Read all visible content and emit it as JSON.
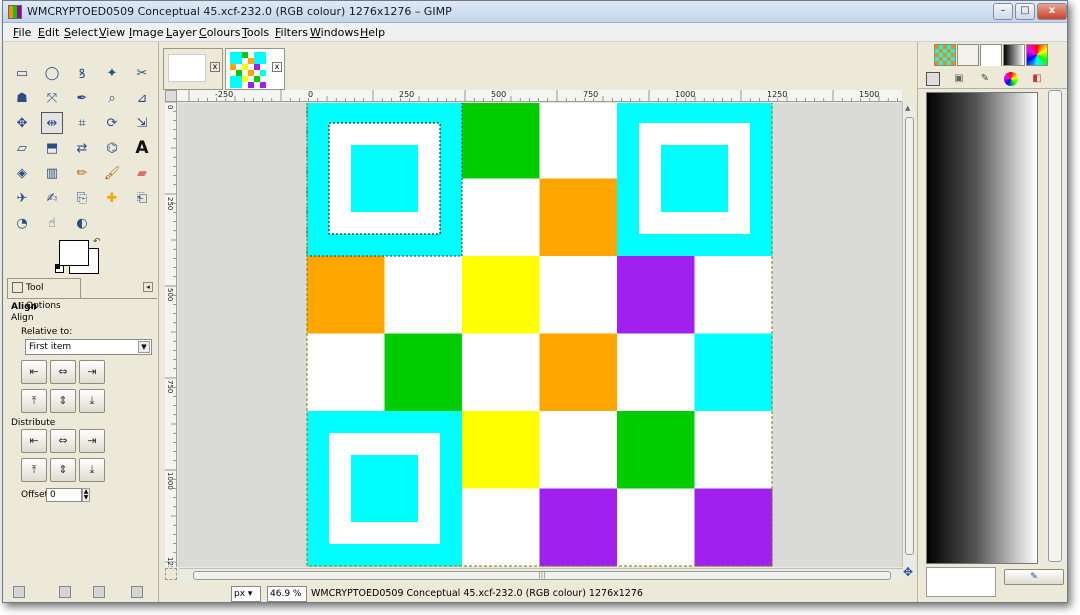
{
  "window": {
    "title": "WMCRYPTOED0509 Conceptual 45.xcf-232.0 (RGB colour) 1276x1276 – GIMP",
    "minimize": "–",
    "maximize": "□",
    "close": "x"
  },
  "menu": [
    "File",
    "Edit",
    "Select",
    "View",
    "Image",
    "Layer",
    "Colours",
    "Tools",
    "Filters",
    "Windows",
    "Help"
  ],
  "toolbox": {
    "tools": [
      "rect-select",
      "ellipse-select",
      "free-select",
      "fuzzy-select",
      "scissors-select",
      "fg-select",
      "paths",
      "color-picker",
      "zoom",
      "measure",
      "move",
      "align",
      "crop",
      "rotate",
      "scale",
      "shear",
      "perspective",
      "flip",
      "cage",
      "text",
      "bucket-fill",
      "blend",
      "pencil",
      "paintbrush",
      "eraser",
      "airbrush",
      "ink",
      "clone",
      "heal",
      "perspective-clone",
      "blur",
      "smudge",
      "dodge-burn"
    ],
    "active_tool": "align",
    "swap_glyph": "↶"
  },
  "tool_options": {
    "tab_label": "Tool Options",
    "panel_menu_glyph": "◂",
    "title": "Align",
    "subtitle": "Align",
    "relative_label": "Relative to:",
    "relative_value": "First item",
    "align_buttons": [
      "⇤",
      "⇔",
      "⇥",
      "⤒",
      "⇕",
      "⤓"
    ],
    "distribute_label": "Distribute",
    "distribute_buttons": [
      "⇤",
      "⇔",
      "⇥",
      "⤒",
      "⇕",
      "⤓"
    ],
    "offset_label": "Offset:",
    "offset_value": "0"
  },
  "image_tabs": [
    {
      "name": "blank-image",
      "close": "x"
    },
    {
      "name": "pattern-image",
      "close": "x"
    }
  ],
  "ruler_h": [
    "-250",
    "0",
    "250",
    "500",
    "750",
    "1000",
    "1250",
    "1500"
  ],
  "ruler_v": [
    "0",
    "250",
    "500",
    "750",
    "1000",
    "1250"
  ],
  "canvas": {
    "grid_colors": [
      [
        "#00ffff",
        "#00ffff",
        "#00cc00",
        "#ffffff",
        "#00ffff",
        "#00ffff"
      ],
      [
        "#00ffff",
        "#00ffff",
        "#ffffff",
        "#ffa500",
        "#00ffff",
        "#00ffff"
      ],
      [
        "#ffa500",
        "#ffffff",
        "#ffff00",
        "#ffffff",
        "#a020f0",
        "#ffffff"
      ],
      [
        "#ffffff",
        "#00cc00",
        "#ffffff",
        "#ffa500",
        "#ffffff",
        "#00ffff"
      ],
      [
        "#00ffff",
        "#00ffff",
        "#ffff00",
        "#ffffff",
        "#00cc00",
        "#ffffff"
      ],
      [
        "#00ffff",
        "#00ffff",
        "#ffffff",
        "#a020f0",
        "#ffffff",
        "#a020f0"
      ]
    ],
    "finder_inner": "#00ffff",
    "finder_ring": "#ffffff"
  },
  "scroll": {
    "center_glyph": "|||"
  },
  "statusbar": {
    "unit": "px",
    "zoom": "46.9 %",
    "text": "WMCRYPTOED0509 Conceptual 45.xcf-232.0 (RGB colour) 1276x1276"
  },
  "dock": {
    "tabs": [
      "patterns",
      "brushes",
      "tool-preset",
      "gradients",
      "palettes"
    ],
    "icons": [
      "gimp-icon",
      "printer-icon",
      "brush-icon",
      "color-wheel-icon",
      "swatch-icon"
    ],
    "gradient_colors": [
      "#000000",
      "#ffffff"
    ]
  }
}
